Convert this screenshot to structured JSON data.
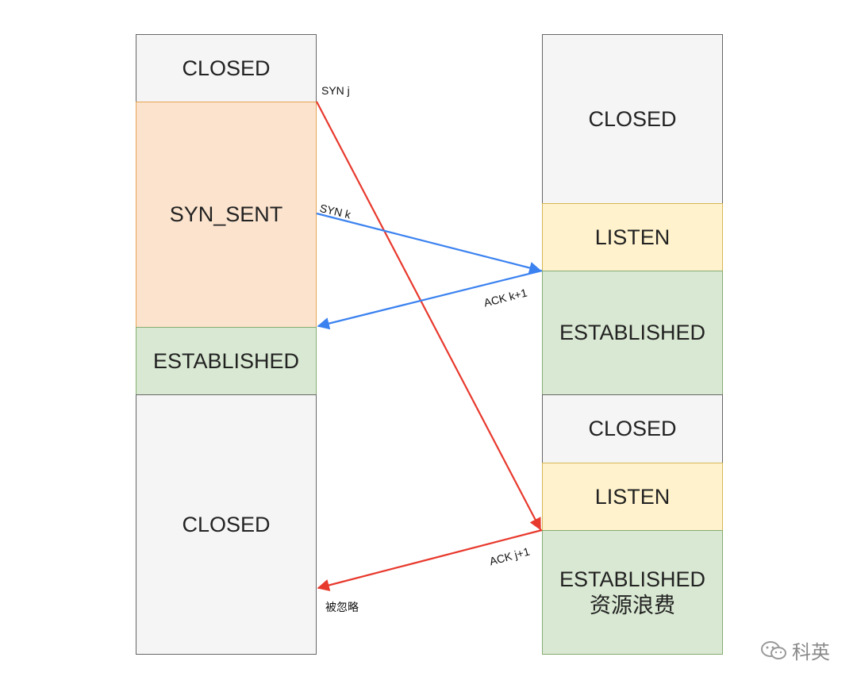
{
  "client": {
    "states": [
      {
        "label": "CLOSED"
      },
      {
        "label": "SYN_SENT"
      },
      {
        "label": "ESTABLISHED"
      },
      {
        "label": "CLOSED"
      }
    ]
  },
  "server": {
    "states": [
      {
        "label": "CLOSED"
      },
      {
        "label": "LISTEN"
      },
      {
        "label": "ESTABLISHED"
      },
      {
        "label": "CLOSED"
      },
      {
        "label": "LISTEN"
      },
      {
        "label": "ESTABLISHED",
        "sublabel": "资源浪费"
      }
    ]
  },
  "messages": {
    "syn_j": "SYN j",
    "syn_k": "SYN k",
    "ack_k1": "ACK k+1",
    "ack_j1": "ACK j+1",
    "ignored": "被忽略"
  },
  "watermark": {
    "text": "科英"
  },
  "colors": {
    "red_arrow": "#e8392d",
    "blue_arrow": "#3b82f0"
  }
}
